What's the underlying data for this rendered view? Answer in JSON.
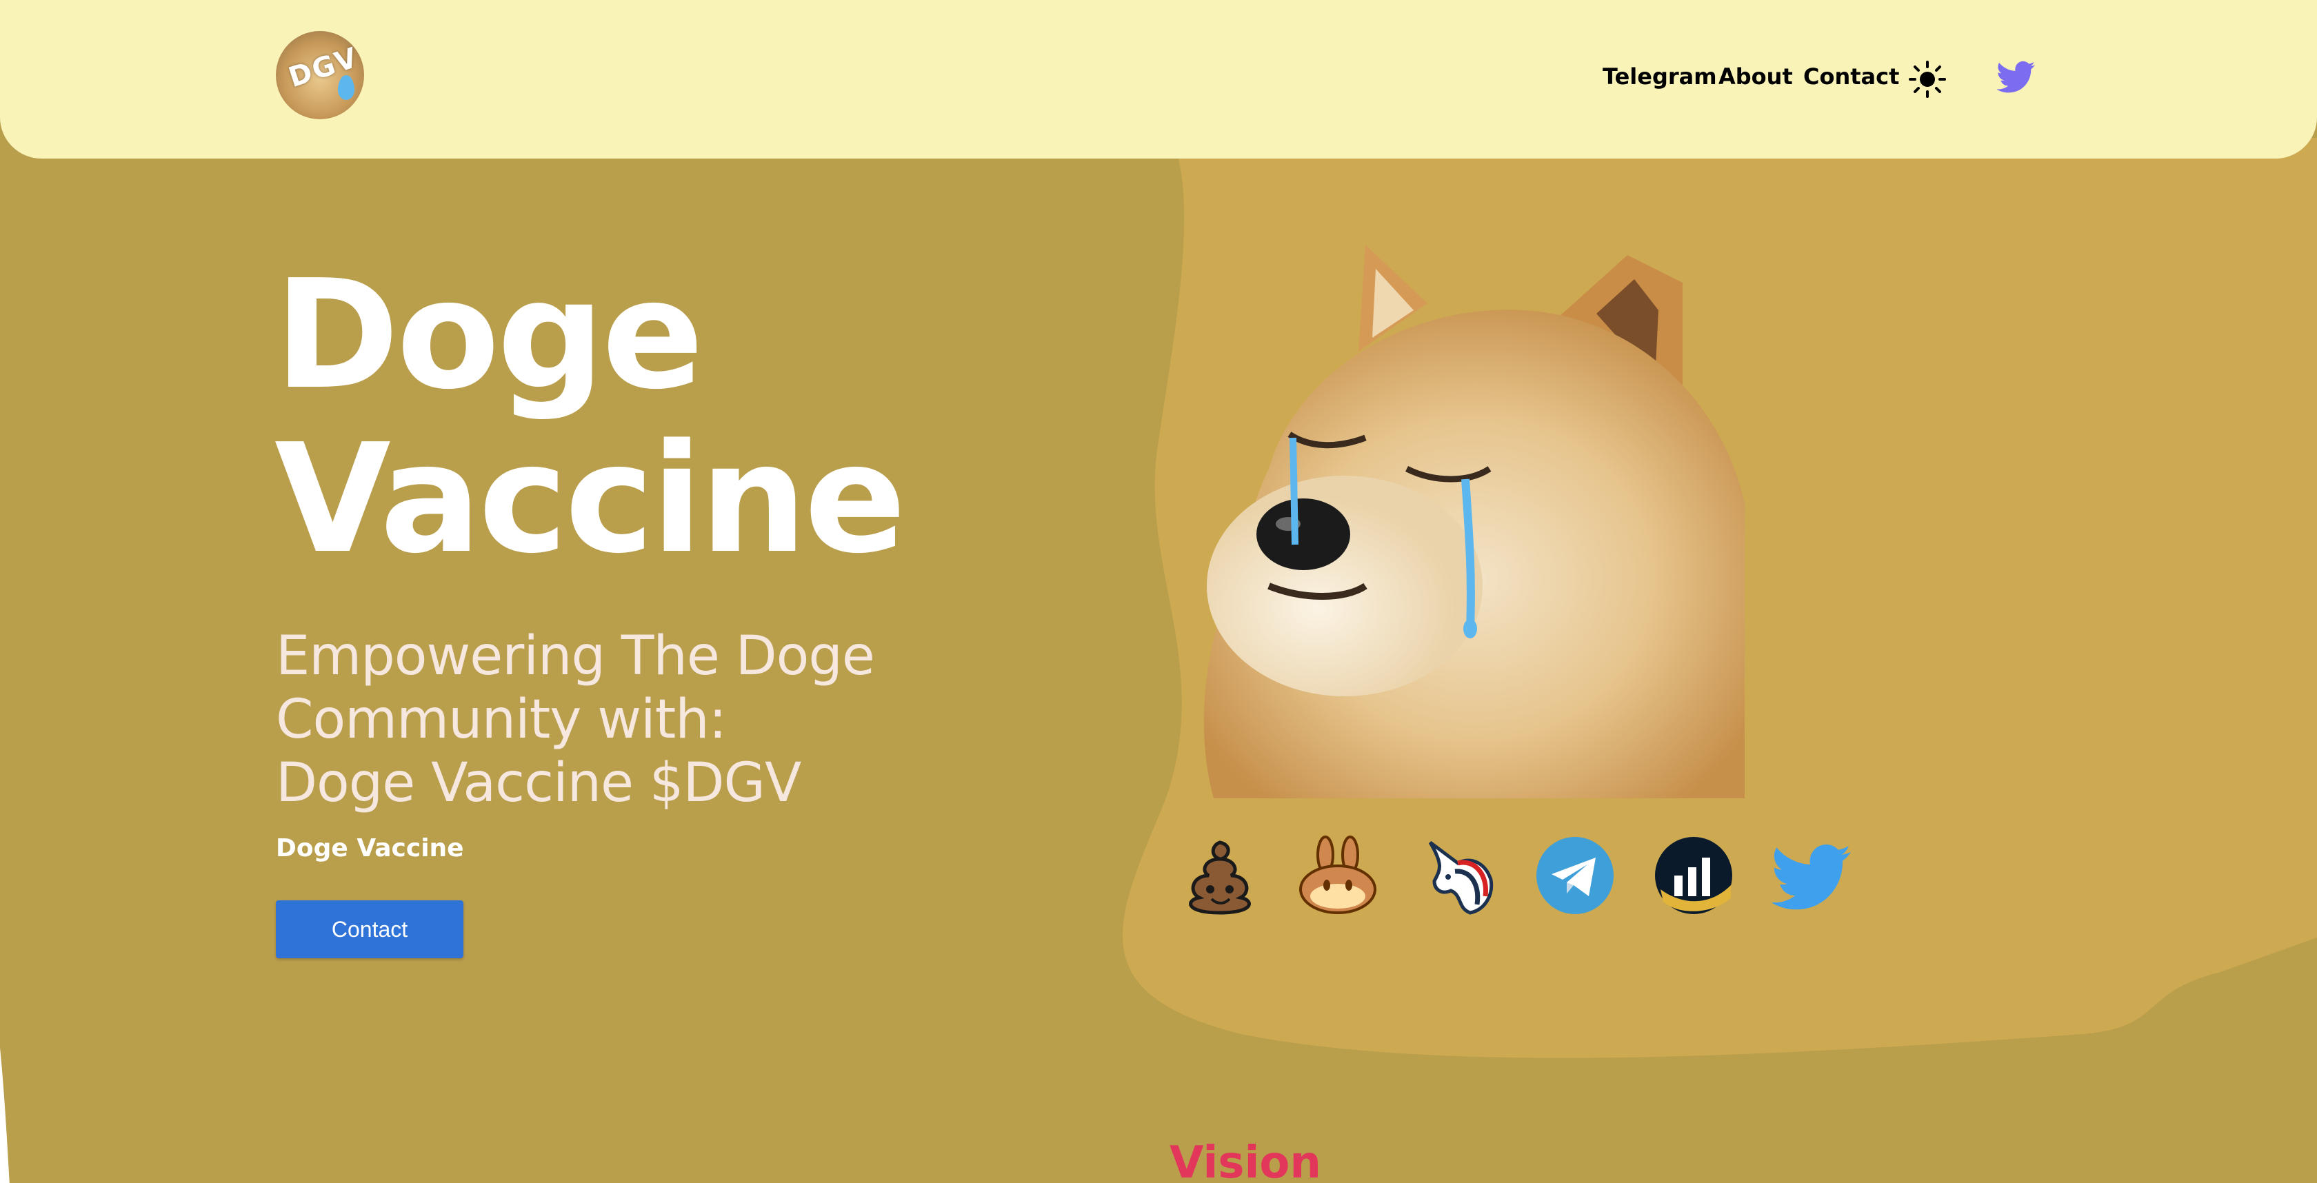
{
  "header": {
    "logo_text": "DGV",
    "nav": {
      "telegram": "Telegram",
      "about": "About",
      "contact": "Contact"
    },
    "theme_toggle_icon": "sun-icon",
    "social_icon": "twitter-icon"
  },
  "hero": {
    "title_line1": "Doge",
    "title_line2": "Vaccine",
    "subtitle_line1": "Empowering The Doge",
    "subtitle_line2": "Community with:",
    "subtitle_line3": "Doge Vaccine $DGV",
    "tagline": "Doge Vaccine",
    "contact_button": "Contact"
  },
  "tokens": [
    {
      "icon": "poop-icon"
    },
    {
      "icon": "pancakeswap-bunny-icon"
    },
    {
      "icon": "1inch-unicorn-icon"
    },
    {
      "icon": "telegram-icon"
    },
    {
      "icon": "dextools-chart-icon"
    },
    {
      "icon": "twitter-icon"
    }
  ],
  "section": {
    "vision_heading": "Vision"
  },
  "colors": {
    "header_bg": "#faf3b8",
    "page_bg": "#b99e4c",
    "blob_bg": "#cdaa52",
    "button_bg": "#2f73d9",
    "heading_accent": "#e2365a"
  }
}
